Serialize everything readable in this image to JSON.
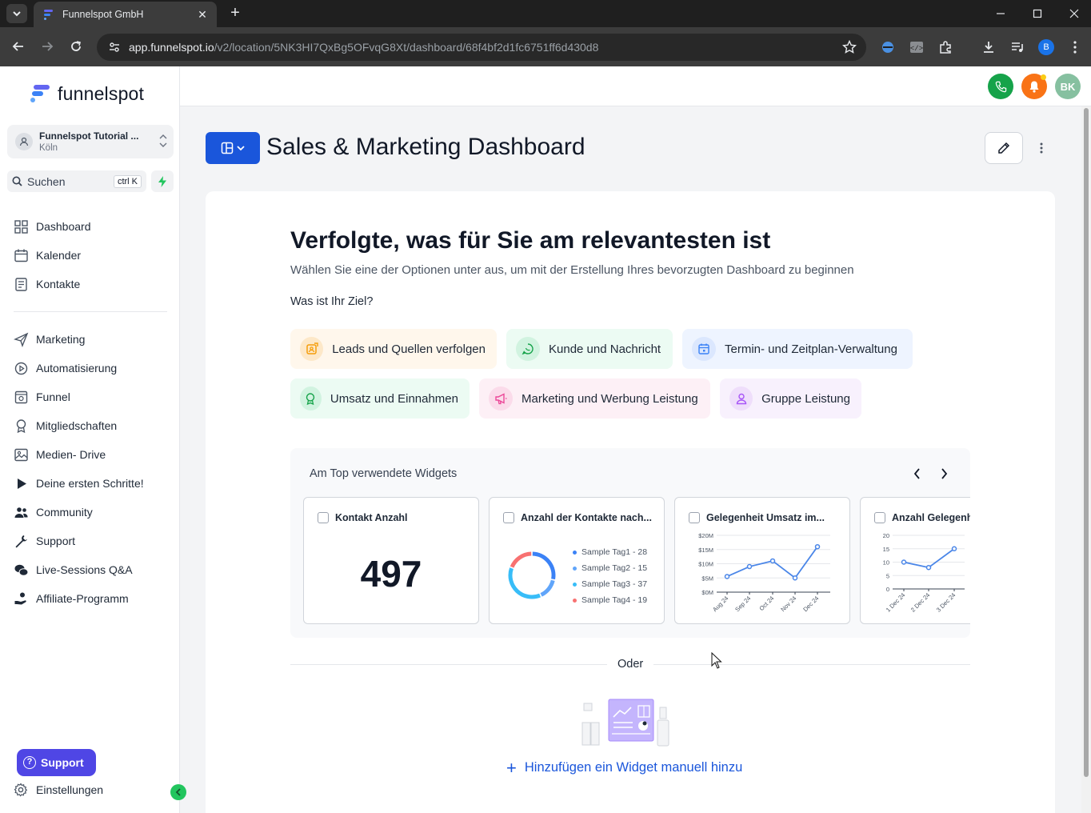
{
  "browser": {
    "tab_title": "Funnelspot GmbH",
    "url_host": "app.funnelspot.io",
    "url_path": "/v2/location/5NK3HI7QxBg5OFvqG8Xt/dashboard/68f4bf2d1fc6751ff6d430d8",
    "profile_initial": "B"
  },
  "sidebar": {
    "logo_text": "funnelspot",
    "account_name": "Funnelspot Tutorial ...",
    "account_city": "Köln",
    "search_label": "Suchen",
    "search_shortcut": "ctrl K",
    "items": [
      {
        "label": "Dashboard",
        "icon": "dashboard-icon"
      },
      {
        "label": "Kalender",
        "icon": "calendar-icon"
      },
      {
        "label": "Kontakte",
        "icon": "contacts-icon"
      },
      {
        "label": "Marketing",
        "icon": "send-icon"
      },
      {
        "label": "Automatisierung",
        "icon": "automation-icon"
      },
      {
        "label": "Funnel",
        "icon": "funnel-icon"
      },
      {
        "label": "Mitgliedschaften",
        "icon": "award-icon"
      },
      {
        "label": "Medien- Drive",
        "icon": "image-icon"
      },
      {
        "label": "Deine ersten Schritte!",
        "icon": "play-icon"
      },
      {
        "label": "Community",
        "icon": "users-icon"
      },
      {
        "label": "Support",
        "icon": "wrench-icon"
      },
      {
        "label": "Live-Sessions Q&A",
        "icon": "chat-icon"
      },
      {
        "label": "Affiliate-Programm",
        "icon": "hand-coin-icon"
      }
    ],
    "support_button": "Support",
    "settings_label": "Einstellungen"
  },
  "topbar": {
    "user_initials": "BK",
    "colors": {
      "phone": "#16a34a",
      "bell": "#f97316",
      "avatar": "#86c0a0"
    }
  },
  "header": {
    "title": "Sales & Marketing Dashboard"
  },
  "onboarding": {
    "heading": "Verfolgte, was für Sie am relevantesten ist",
    "subheading": "Wählen Sie eine der Optionen unter aus, um mit der Erstellung Ihres bevorzugten Dashboard zu beginnen",
    "goal_label": "Was ist Ihr Ziel?",
    "options": [
      {
        "label": "Leads und Quellen verfolgen",
        "bg": "#fff7ec",
        "icon_bg": "#fde8c8",
        "icon_color": "#f59e0b"
      },
      {
        "label": "Kunde und Nachricht",
        "bg": "#ecfbf3",
        "icon_bg": "#d1f3e0",
        "icon_color": "#16a34a"
      },
      {
        "label": "Termin- und Zeitplan-Verwaltung",
        "bg": "#eef4ff",
        "icon_bg": "#dbe7fe",
        "icon_color": "#3b82f6"
      },
      {
        "label": "Umsatz und Einnahmen",
        "bg": "#ecfbf3",
        "icon_bg": "#d1f3e0",
        "icon_color": "#16a34a"
      },
      {
        "label": "Marketing und Werbung Leistung",
        "bg": "#fdf0f6",
        "icon_bg": "#fbdbea",
        "icon_color": "#ec4899"
      },
      {
        "label": "Gruppe Leistung",
        "bg": "#f8f1fd",
        "icon_bg": "#efdefb",
        "icon_color": "#a855f7"
      }
    ],
    "widgets_title": "Am Top verwendete Widgets",
    "widgets": [
      {
        "title": "Kontakt Anzahl",
        "value": "497"
      },
      {
        "title": "Anzahl der Kontakte nach...",
        "legend": [
          "Sample Tag1 - 28",
          "Sample Tag2 - 15",
          "Sample Tag3 - 37",
          "Sample Tag4 - 19"
        ],
        "legend_colors": [
          "#3b82f6",
          "#60a5fa",
          "#38bdf8",
          "#f87171"
        ]
      },
      {
        "title": "Gelegenheit Umsatz im..."
      },
      {
        "title": "Anzahl Gelegenheiten"
      }
    ],
    "or_label": "Oder",
    "add_widget_label": "Hinzufügen ein Widget manuell hinzu"
  },
  "chart_data": [
    {
      "type": "pie",
      "title": "Anzahl der Kontakte nach...",
      "categories": [
        "Sample Tag1",
        "Sample Tag2",
        "Sample Tag3",
        "Sample Tag4"
      ],
      "values": [
        28,
        15,
        37,
        19
      ],
      "legend": "right"
    },
    {
      "type": "line",
      "title": "Gelegenheit Umsatz im...",
      "categories": [
        "Aug 24",
        "Sep 24",
        "Oct 24",
        "Nov 24",
        "Dec 24"
      ],
      "series": [
        {
          "values": [
            5.5,
            9,
            11,
            5,
            16
          ]
        }
      ],
      "yticks": [
        "$0M",
        "$5M",
        "$10M",
        "$15M",
        "$20M"
      ],
      "ylim": [
        0,
        20
      ]
    },
    {
      "type": "line",
      "title": "Anzahl Gelegenheiten",
      "categories": [
        "1 Dec 24",
        "2 Dec 24",
        "3 Dec 24"
      ],
      "series": [
        {
          "values": [
            10,
            8,
            15
          ]
        }
      ],
      "yticks": [
        "0",
        "5",
        "10",
        "15",
        "20"
      ],
      "ylim": [
        0,
        20
      ]
    }
  ]
}
